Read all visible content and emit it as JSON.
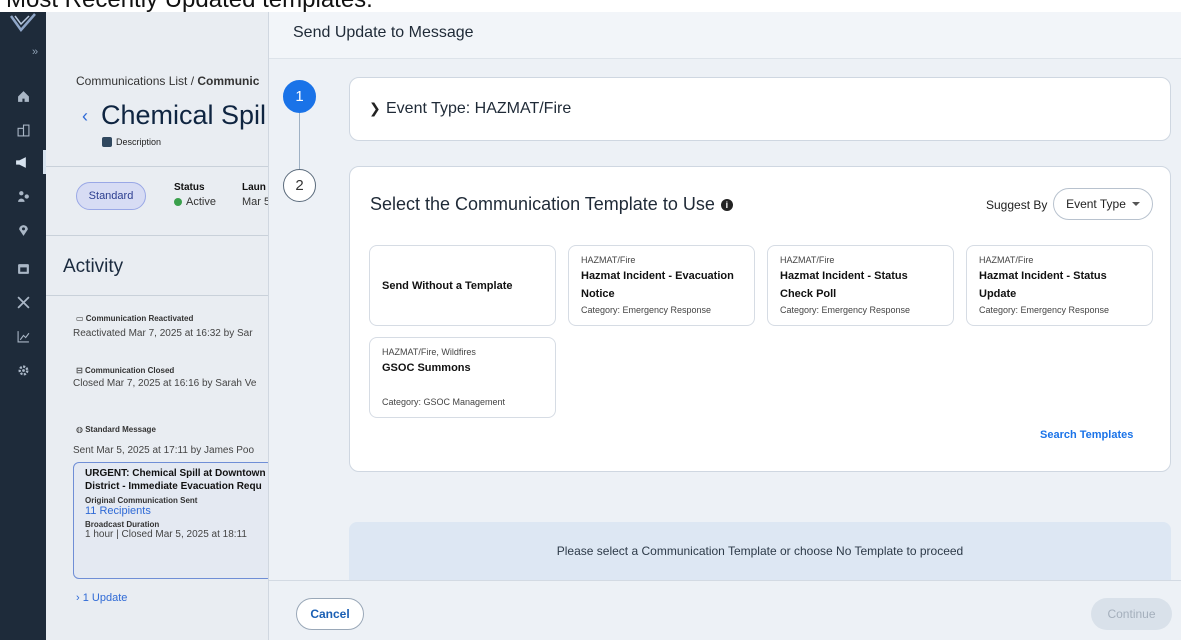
{
  "caption": "Most Recently Updated templates.",
  "background": {
    "breadcrumb_root": "Communications List / ",
    "breadcrumb_current": "Communic",
    "title": "Chemical Spil",
    "description_label": "Description",
    "badge": "Standard",
    "status_label": "Status",
    "status_value": "Active",
    "launch_label": "Laun",
    "launch_value": "Mar 5",
    "activity_title": "Activity",
    "events": [
      {
        "heading": "Communication Reactivated",
        "text": "Reactivated Mar 7, 2025 at 16:32 by Sar"
      },
      {
        "heading": "Communication Closed",
        "text": "Closed Mar 7, 2025 at 16:16 by Sarah Ve"
      },
      {
        "heading": "Standard Message",
        "text": "Sent Mar 5, 2025 at 17:11 by James Poo"
      }
    ],
    "card": {
      "line1": "URGENT: Chemical Spill at Downtown",
      "line2": "District - Immediate Evacuation Requ",
      "original_label": "Original Communication Sent",
      "recipients": "11 Recipients",
      "duration_label": "Broadcast Duration",
      "duration_value": "1 hour | Closed Mar 5, 2025 at 18:11"
    },
    "update_link": "1 Update"
  },
  "modal": {
    "title": "Send Update to Message",
    "step1_number": "1",
    "step2_number": "2",
    "event_type": "Event Type: HAZMAT/Fire",
    "template_heading": "Select the Communication Template to Use",
    "info_glyph": "i",
    "suggest_label": "Suggest By",
    "suggest_value": "Event Type",
    "templates": [
      {
        "event": "",
        "name": "Send Without a Template",
        "category": ""
      },
      {
        "event": "HAZMAT/Fire",
        "name": "Hazmat Incident - Evacuation Notice",
        "category": "Category: Emergency Response"
      },
      {
        "event": "HAZMAT/Fire",
        "name": "Hazmat Incident - Status Check Poll",
        "category": "Category: Emergency Response"
      },
      {
        "event": "HAZMAT/Fire",
        "name": "Hazmat Incident - Status Update",
        "category": "Category: Emergency Response"
      },
      {
        "event": "HAZMAT/Fire, Wildfires",
        "name": "GSOC Summons",
        "category": "Category: GSOC Management"
      }
    ],
    "search_templates": "Search Templates",
    "notice": "Please select a Communication Template or choose No Template to proceed",
    "cancel": "Cancel",
    "continue": "Continue"
  },
  "colors": {
    "accent": "#1a73e8",
    "rail": "#1e2b3a",
    "status_active": "#3aa04c"
  },
  "icons": [
    "home-icon",
    "buildings-icon",
    "megaphone-icon",
    "people-icon",
    "location-icon",
    "calendar-icon",
    "tools-icon",
    "chart-icon",
    "gear-icon"
  ]
}
